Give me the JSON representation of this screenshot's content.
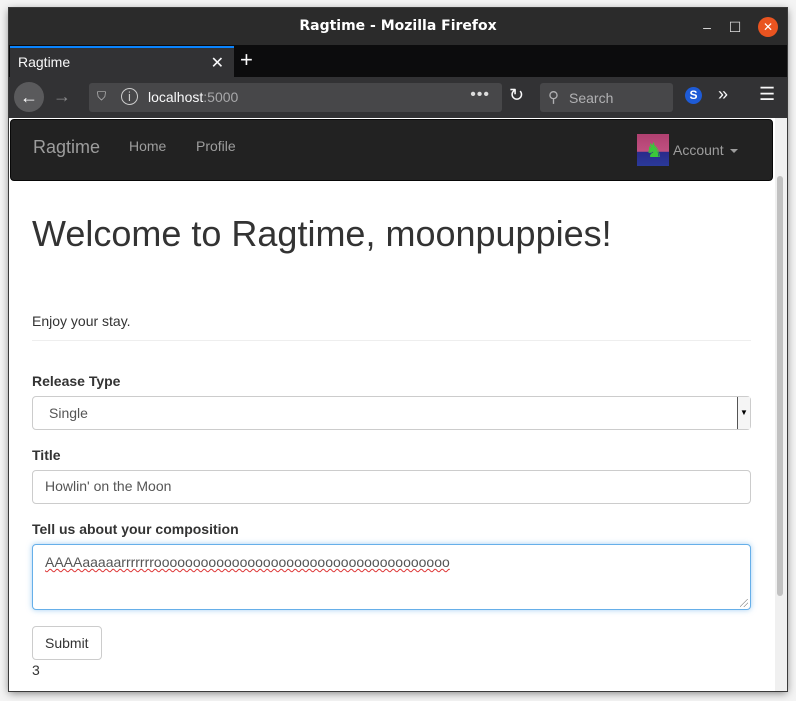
{
  "window": {
    "title": "Ragtime - Mozilla Firefox"
  },
  "browser": {
    "tab_label": "Ragtime",
    "url_host": "localhost",
    "url_port": ":5000",
    "search_placeholder": "Search",
    "icons": [
      "back-arrow-icon",
      "forward-arrow-icon",
      "shield-icon",
      "info-icon",
      "more-dots-icon",
      "reload-icon",
      "search-icon",
      "extension-s-icon",
      "overflow-chevron-icon",
      "hamburger-menu-icon"
    ]
  },
  "app_nav": {
    "brand": "Ragtime",
    "links": [
      "Home",
      "Profile"
    ],
    "account_label": "Account"
  },
  "page": {
    "heading": "Welcome to Ragtime, moonpuppies!",
    "lead": "Enjoy your stay.",
    "release_type_label": "Release Type",
    "release_type_value": "Single",
    "title_label": "Title",
    "title_value": "Howlin' on the Moon",
    "composition_label": "Tell us about your composition",
    "composition_value": "AAAAaaaaarrrrrrroooooooooooooooooooooooooooooooooooooo",
    "submit_label": "Submit",
    "count": "3"
  },
  "colors": {
    "navbar_bg": "#222222",
    "focus_border": "#66afe9",
    "firefox_accent": "#0a84ff",
    "close_button": "#e95420"
  }
}
